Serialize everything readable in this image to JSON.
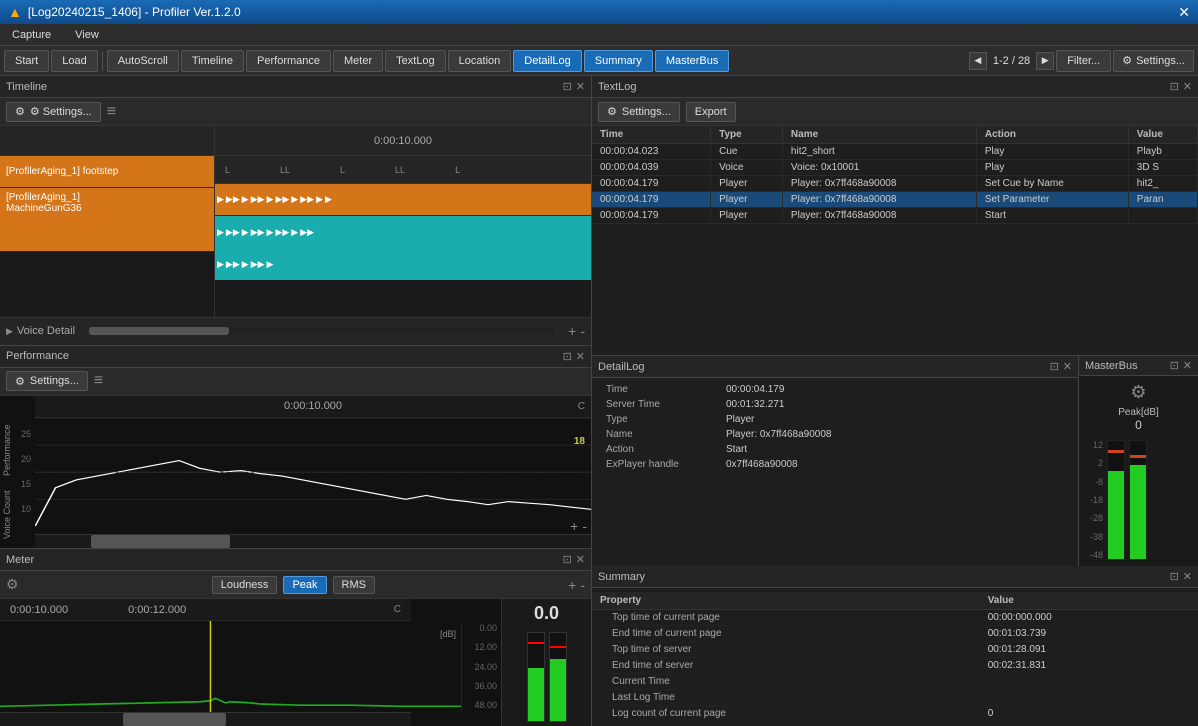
{
  "titlebar": {
    "title": "[Log20240215_1406] - Profiler Ver.1.2.0",
    "close": "✕"
  },
  "menubar": {
    "items": [
      "Capture",
      "View"
    ]
  },
  "toolbar": {
    "start": "Start",
    "load": "Load",
    "autoscroll": "AutoScroll",
    "timeline": "Timeline",
    "performance": "Performance",
    "meter": "Meter",
    "textlog": "TextLog",
    "location": "Location",
    "detaillog": "DetailLog",
    "summary": "Summary",
    "masterbus": "MasterBus",
    "page_prev": "◀",
    "page_info": "1-2 / 28",
    "page_next": "▶",
    "filter": "Filter...",
    "settings_icon": "⚙",
    "settings": "Settings..."
  },
  "timeline": {
    "panel_title": "Timeline",
    "settings_btn": "⚙ Settings...",
    "hamburger": "≡",
    "time_header": "0:00:10.000",
    "track1_label": "[ProfilerAging_1] footstep",
    "track2_label": "[ProfilerAging_1]\nMachineGunG36",
    "level_markers": [
      "L",
      "LL",
      "L",
      "LL",
      "L"
    ],
    "plus": "+",
    "minus": "-"
  },
  "voice_detail": {
    "label": "Voice Detail",
    "triangle": "▶"
  },
  "performance": {
    "panel_title": "Performance",
    "settings_btn": "⚙ Settings...",
    "hamburger": "≡",
    "time_header": "0:00:10.000",
    "right_val": "C",
    "y_labels": [
      "25",
      "20",
      "15",
      "10"
    ],
    "peak_label": "18",
    "left_label": "Performance",
    "voice_count_label": "Voice Count",
    "plus": "+",
    "minus": "-"
  },
  "meter": {
    "panel_title": "Meter",
    "settings_icon": "⚙",
    "tab_loudness": "Loudness",
    "tab_peak": "Peak",
    "tab_rms": "RMS",
    "time1": "0:00:10.000",
    "time2": "0:00:12.000",
    "right_val": "C",
    "db_label": "[dB]",
    "db_value": "0.0",
    "y_labels": [
      "0.00",
      "12.00",
      "24.00",
      "36.00",
      "48.00"
    ],
    "plus": "+",
    "minus": "-"
  },
  "textlog": {
    "panel_title": "TextLog",
    "settings_btn": "⚙ Settings...",
    "export_btn": "Export",
    "columns": [
      "Time",
      "Type",
      "Name",
      "Action",
      "Value"
    ],
    "rows": [
      [
        "00:00:04.023",
        "Cue",
        "hit2_short",
        "Play",
        "Playb"
      ],
      [
        "00:00:04.039",
        "Voice",
        "Voice: 0x10001",
        "Play",
        "3D S"
      ],
      [
        "00:00:04.179",
        "Player",
        "Player: 0x7ff468a90008",
        "Set Cue by Name",
        "hit2_"
      ],
      [
        "00:00:04.179",
        "Player",
        "Player: 0x7ff468a90008",
        "Set Parameter",
        "Paran"
      ],
      [
        "00:00:04.179",
        "Player",
        "Player: 0x7ff468a90008",
        "Start",
        ""
      ]
    ],
    "selected_row": 4
  },
  "detaillog": {
    "panel_title": "DetailLog",
    "properties": [
      [
        "Time",
        "00:00:04.179"
      ],
      [
        "Server Time",
        "00:01:32.271"
      ],
      [
        "Type",
        "Player"
      ],
      [
        "Name",
        "Player: 0x7ff468a90008"
      ],
      [
        "Action",
        "Start"
      ],
      [
        "ExPlayer handle",
        "0x7ff468a90008"
      ]
    ]
  },
  "masterbus": {
    "panel_title": "MasterBus",
    "gear": "⚙",
    "peak_label": "Peak[dB]",
    "peak_value": "0",
    "scale_labels": [
      "12",
      "2",
      "-8",
      "-18",
      "-28",
      "-38",
      "-48"
    ],
    "bar1_height": "60",
    "bar2_height": "70",
    "bar1_color": "#22cc22",
    "bar2_color": "#22cc22",
    "bar1_peak_pct": "85",
    "bar2_peak_pct": "80"
  },
  "summary": {
    "panel_title": "Summary",
    "columns": [
      "Property",
      "Value"
    ],
    "rows": [
      [
        "Top time of current page",
        "00:00:000.000"
      ],
      [
        "End time of current page",
        "00:01:03.739"
      ],
      [
        "Top time of server",
        "00:01:28.091"
      ],
      [
        "End time of server",
        "00:02:31.831"
      ],
      [
        "Current Time",
        ""
      ],
      [
        "Last Log Time",
        ""
      ],
      [
        "Log count of current page",
        "0"
      ]
    ]
  }
}
